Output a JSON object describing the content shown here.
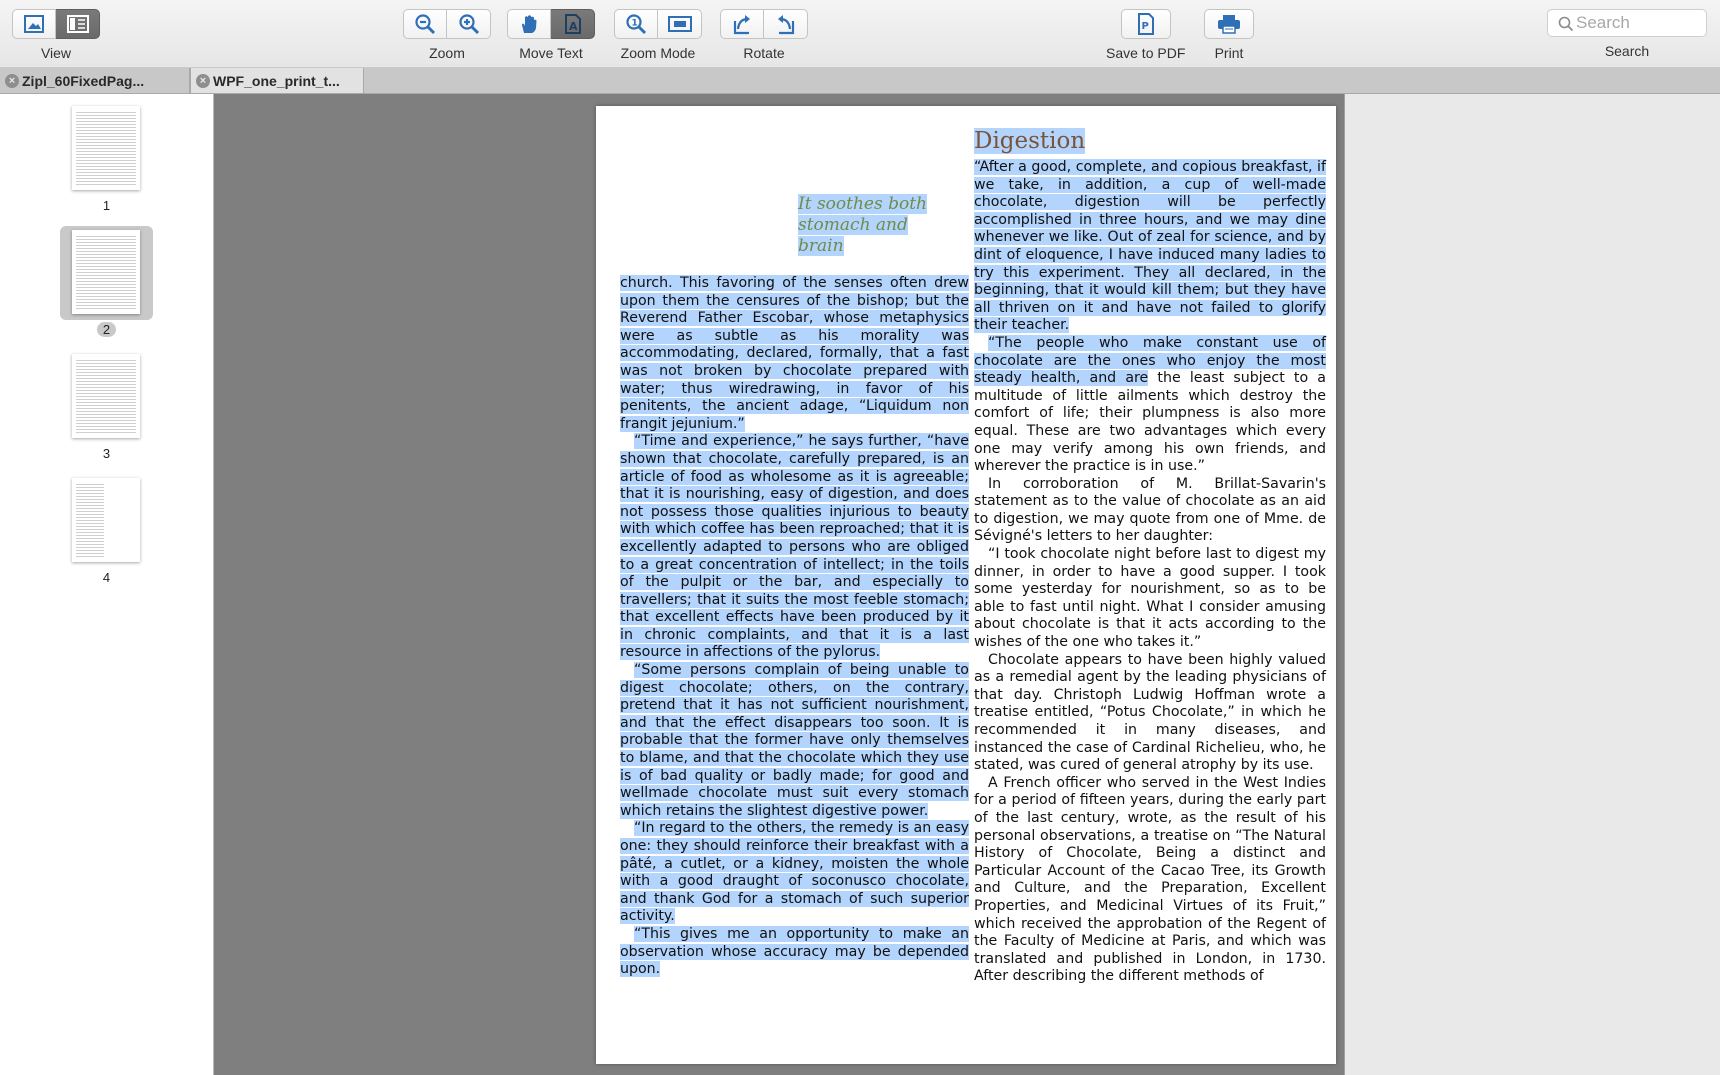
{
  "toolbar": {
    "view_label": "View",
    "zoom_label": "Zoom",
    "move_text_label": "Move Text",
    "zoom_mode_label": "Zoom Mode",
    "rotate_label": "Rotate",
    "save_pdf_label": "Save to PDF",
    "print_label": "Print",
    "search_label": "Search",
    "search_placeholder": "Search"
  },
  "tabs": [
    {
      "title": "Zipl_60FixedPag..."
    },
    {
      "title": "WPF_one_print_t..."
    }
  ],
  "sidebar": {
    "pages": [
      "1",
      "2",
      "3",
      "4"
    ],
    "selected_page": "2"
  },
  "document": {
    "pullquote": "It soothes both stomach and brain",
    "heading": "Digestion",
    "left_column": [
      "church. This favoring of the senses often drew upon them the censures of the bishop; but the Reverend Father Escobar, whose metaphysics were as subtle as his morality was accommodating, declared, formally, that a fast was not broken by chocolate prepared with water; thus wiredrawing, in favor of his penitents, the ancient adage, “Liquidum non frangit jejunium.”",
      "“Time and experience,” he says further, “have shown that chocolate, carefully prepared, is an article of food as wholesome as it is agreeable; that it is nourishing, easy of digestion, and does not possess those qualities injurious to beauty with which coffee has been reproached; that it is excellently adapted to persons who are obliged to a great concentration of intellect; in the toils of the pulpit or the bar, and especially to travellers; that it suits the most feeble stomach; that excellent effects have been produced by it in chronic complaints, and that it is a last resource in affections of the pylorus.",
      "“Some persons complain of being unable to digest chocolate; others, on the contrary, pretend that it has not sufficient nourishment, and that the effect disappears too soon. It is probable that the former have only themselves to blame, and that the chocolate which they use is of bad quality or badly made; for good and wellmade chocolate must suit every stomach which retains the slightest digestive power.",
      "“In regard to the others, the remedy is an easy one: they should reinforce their breakfast with a pâté, a cutlet, or a kidney, moisten the whole with a good draught of soconusco chocolate, and thank God for a stomach of such superior activity.",
      "“This gives me an opportunity to make an observation whose accuracy may be depended upon."
    ],
    "right_p1": "“After a good, complete, and copious breakfast, if we take, in addition, a cup of well-made chocolate, digestion will be perfectly accomplished in three hours, and we may dine whenever we like. Out of zeal for science, and by dint of eloquence, I have induced many ladies to try this experiment. They all declared, in the beginning, that it would kill them; but they have all thriven on it and have not failed to glorify their teacher.",
    "right_p2_highlighted": "“The people who make constant use of chocolate are the ones who enjoy the most steady health, and are",
    "right_p2_rest": " the least subject to a multitude of little ailments which destroy the comfort of life; their plumpness is also more equal. These are two advantages which every one may verify among his own friends, and wherever the practice is in use.”",
    "right_rest": [
      "In corroboration of M. Brillat-Savarin's statement as to the value of chocolate as an aid to digestion, we may quote from one of Mme. de Sévigné's letters to her daughter:",
      "“I took chocolate night before last to digest my dinner, in order to have a good supper. I took some yesterday for nourishment, so as to be able to fast until night. What I consider amusing about chocolate is that it acts according to the wishes of the one who takes it.”",
      "Chocolate appears to have been highly valued as a remedial agent by the leading physicians of that day. Christoph Ludwig Hoffman wrote a treatise entitled, “Potus Chocolate,” in which he recommended it in many diseases, and instanced the case of Cardinal Richelieu, who, he stated, was cured of general atrophy by its use.",
      "A French officer who served in the West Indies for a period of fifteen years, during the early part of the last century, wrote, as the result of his personal observations, a treatise on “The Natural History of Chocolate, Being a distinct and Particular Account of the Cacao Tree, its Growth and Culture, and the Preparation, Excellent Properties, and Medicinal Virtues of its Fruit,” which received the approbation of the Regent of the Faculty of Medicine at Paris, and which was translated and published in London, in 1730. After describing the different methods of"
    ]
  },
  "colors": {
    "selection": "#b3d4fc",
    "pullquote": "#6f8c4a",
    "heading": "#7a5338",
    "canvas": "#7f7f7f"
  }
}
